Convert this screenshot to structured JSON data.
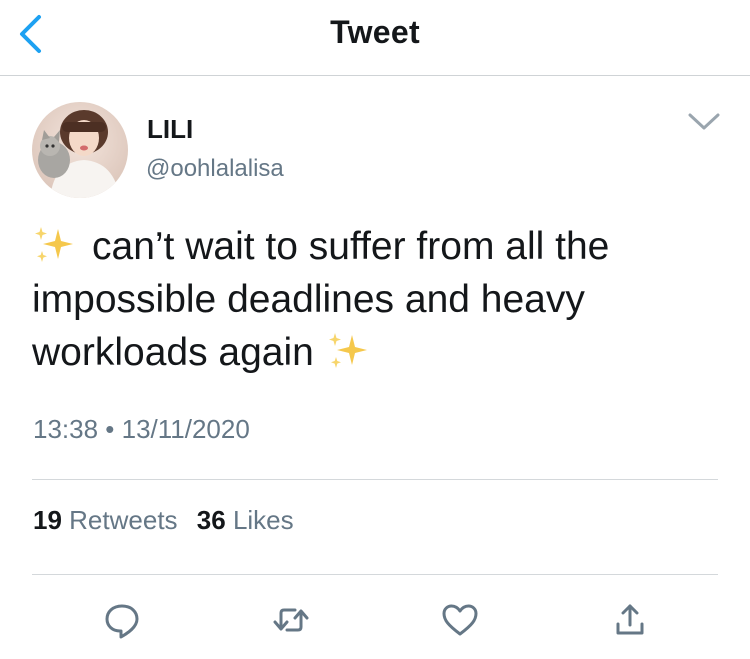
{
  "header": {
    "title": "Tweet",
    "back_icon": "chevron-left-icon",
    "accent_color": "#1da1f2"
  },
  "tweet": {
    "author": {
      "name": "LILI",
      "handle": "@oohlalalisa",
      "avatar": "profile-photo"
    },
    "text": "can’t wait to suffer from all the impossible deadlines and heavy workloads again",
    "emoji": "sparkles",
    "emoji_char": "✨",
    "timestamp": "13:38 • 13/11/2020",
    "stats": {
      "retweets_count": "19",
      "retweets_label": "Retweets",
      "likes_count": "36",
      "likes_label": "Likes"
    },
    "more_icon": "chevron-down-icon"
  },
  "actions": [
    {
      "name": "reply",
      "icon": "reply-icon"
    },
    {
      "name": "retweet",
      "icon": "retweet-icon"
    },
    {
      "name": "like",
      "icon": "heart-icon"
    },
    {
      "name": "share",
      "icon": "share-icon"
    }
  ],
  "colors": {
    "text_primary": "#14171a",
    "text_secondary": "#657786",
    "divider": "#d4d8db",
    "sparkle": "#f5c84c"
  }
}
